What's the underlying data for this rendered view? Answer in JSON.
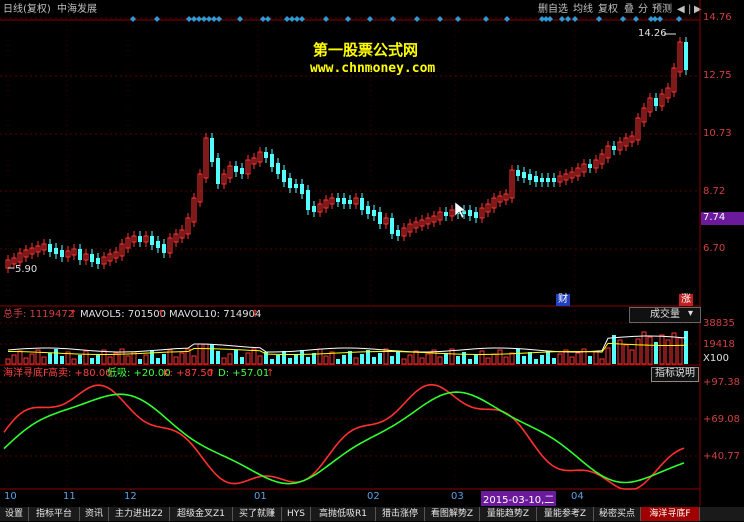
{
  "header": {
    "left_items": [
      "日线(复权)",
      "中海发展"
    ],
    "buttons": [
      "删自选",
      "均线",
      "复权",
      "叠",
      "分",
      "预测"
    ],
    "nav_icons": [
      "triangle-left-icon",
      "vertical-bar-icon",
      "triangle-right-icon"
    ]
  },
  "watermark": {
    "line1": "第一股票公式网",
    "line2": "www.chnmoney.com"
  },
  "price_axis": [
    "14.76",
    "12.75",
    "10.73",
    "8.72",
    "7.74",
    "6.70"
  ],
  "price_annotations": {
    "high": "14.26",
    "low": "5.90"
  },
  "badges": {
    "cai": "财",
    "zhang": "涨"
  },
  "volume_panel": {
    "header": [
      "总手: 1119472",
      "MAVOL5: 701500",
      "MAVOL10: 714904"
    ],
    "selector": "成交量",
    "axis": [
      "38835",
      "19418",
      "X100"
    ]
  },
  "indicator_panel": {
    "name": "海洋寻底F",
    "fields": [
      "高卖: +80.00",
      "低吸: +20.00",
      "K: +87.50",
      "D: +57.01"
    ],
    "help_button": "指标说明",
    "axis": [
      "+97.38",
      "+69.08",
      "+40.77"
    ]
  },
  "x_axis": {
    "labels": [
      "10",
      "11",
      "12",
      "01",
      "02",
      "03",
      "04"
    ],
    "cursor_date": "2015-03-10,二"
  },
  "tabs": [
    "设置",
    "指标平台",
    "资讯",
    "主力进出Z2",
    "超级金叉Z1",
    "买了就赚",
    "HYS",
    "高抛低吸R1",
    "猎击涨停",
    "看图解势Z",
    "量能趋势Z",
    "量能参考Z",
    "秘密买点",
    "海洋寻底F"
  ],
  "active_tab": "海洋寻底F",
  "colors": {
    "up": "#ff3232",
    "down": "#54ffff",
    "k_line": "#ff3030",
    "d_line": "#30ff30",
    "volume_line": "#ffffff",
    "grid": "#8b0000",
    "accent": "#ffff00"
  }
}
